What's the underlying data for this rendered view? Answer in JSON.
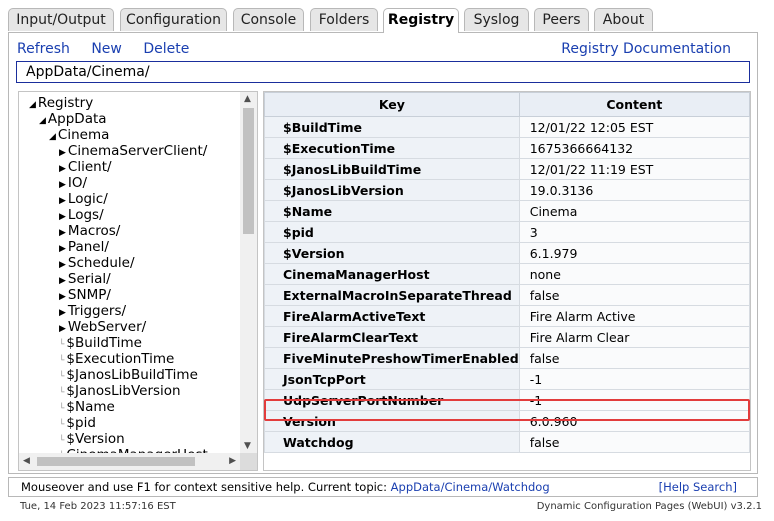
{
  "tabs": [
    "Input/Output",
    "Configuration",
    "Console",
    "Folders",
    "Registry",
    "Syslog",
    "Peers",
    "About"
  ],
  "active_tab": "Registry",
  "toolbar": {
    "refresh": "Refresh",
    "new": "New",
    "delete": "Delete",
    "docs": "Registry Documentation"
  },
  "path": "AppData/Cinema/",
  "tree": {
    "items": [
      {
        "label": "Registry",
        "marker": "◢"
      },
      {
        "label": "AppData",
        "marker": "◢"
      },
      {
        "label": "Cinema",
        "marker": "◢"
      },
      {
        "label": "CinemaServerClient/",
        "marker": "▶"
      },
      {
        "label": "Client/",
        "marker": "▶"
      },
      {
        "label": "IO/",
        "marker": "▶"
      },
      {
        "label": "Logic/",
        "marker": "▶"
      },
      {
        "label": "Logs/",
        "marker": "▶"
      },
      {
        "label": "Macros/",
        "marker": "▶"
      },
      {
        "label": "Panel/",
        "marker": "▶"
      },
      {
        "label": "Schedule/",
        "marker": "▶"
      },
      {
        "label": "Serial/",
        "marker": "▶"
      },
      {
        "label": "SNMP/",
        "marker": "▶"
      },
      {
        "label": "Triggers/",
        "marker": "▶"
      },
      {
        "label": "WebServer/",
        "marker": "▶"
      },
      {
        "label": "$BuildTime",
        "marker": "└"
      },
      {
        "label": "$ExecutionTime",
        "marker": "└"
      },
      {
        "label": "$JanosLibBuildTime",
        "marker": "└"
      },
      {
        "label": "$JanosLibVersion",
        "marker": "└"
      },
      {
        "label": "$Name",
        "marker": "└"
      },
      {
        "label": "$pid",
        "marker": "└"
      },
      {
        "label": "$Version",
        "marker": "└"
      },
      {
        "label": "CinemaManagerHost",
        "marker": "└"
      }
    ]
  },
  "table": {
    "headers": [
      "Key",
      "Content"
    ],
    "rows": [
      [
        "$BuildTime",
        "12/01/22 12:05 EST"
      ],
      [
        "$ExecutionTime",
        "1675366664132"
      ],
      [
        "$JanosLibBuildTime",
        "12/01/22 11:19 EST"
      ],
      [
        "$JanosLibVersion",
        "19.0.3136"
      ],
      [
        "$Name",
        "Cinema"
      ],
      [
        "$pid",
        "3"
      ],
      [
        "$Version",
        "6.1.979"
      ],
      [
        "CinemaManagerHost",
        "none"
      ],
      [
        "ExternalMacroInSeparateThread",
        "false"
      ],
      [
        "FireAlarmActiveText",
        "Fire Alarm Active"
      ],
      [
        "FireAlarmClearText",
        "Fire Alarm Clear"
      ],
      [
        "FiveMinutePreshowTimerEnabled",
        "false"
      ],
      [
        "JsonTcpPort",
        "-1"
      ],
      [
        "UdpServerPortNumber",
        "-1"
      ],
      [
        "Version",
        "6.0.960"
      ],
      [
        "Watchdog",
        "false"
      ]
    ]
  },
  "help": {
    "text": "Mouseover and use F1 for context sensitive help. Current topic:",
    "topic": "AppData/Cinema/Watchdog",
    "search": "[Help Search]"
  },
  "status": {
    "datetime": "Tue, 14 Feb 2023 11:57:16 EST",
    "version": "Dynamic Configuration Pages (WebUI) v3.2.1"
  },
  "colors": {
    "link": "#1a3fb0",
    "highlight": "#e23c3c",
    "path_border": "#1a2e9c"
  }
}
